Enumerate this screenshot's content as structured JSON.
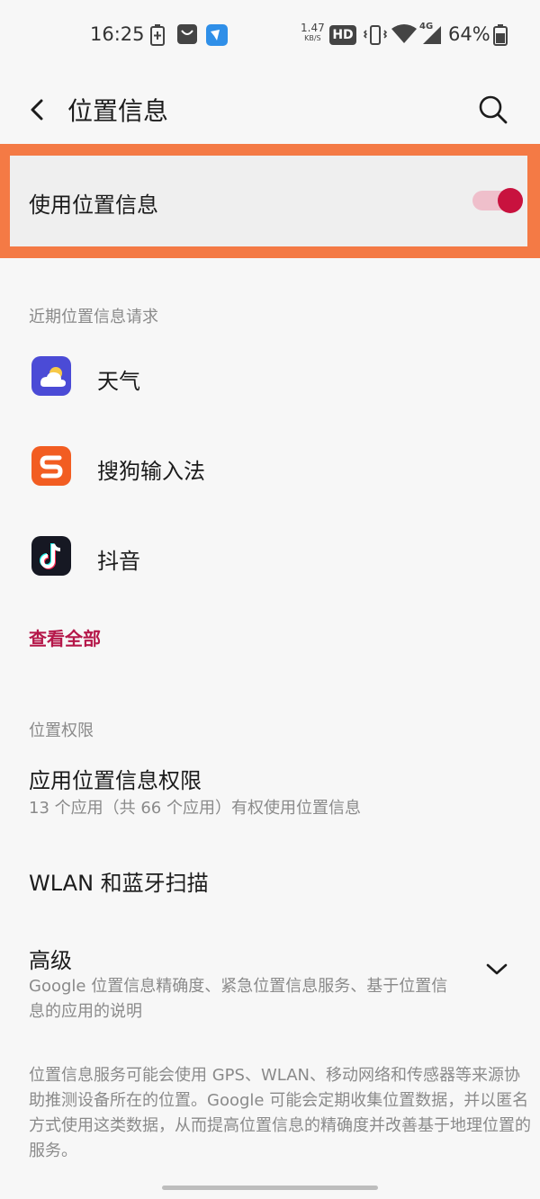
{
  "status_bar": {
    "time": "16:25",
    "net_speed": "1.47",
    "net_speed_unit": "KB/S",
    "hd_badge": "HD",
    "network_type": "4G",
    "battery": "64%"
  },
  "header": {
    "title": "位置信息",
    "back_icon": "back-arrow-icon",
    "search_icon": "search-icon"
  },
  "master_switch": {
    "label": "使用位置信息",
    "enabled": true,
    "accent": "#c8123e",
    "highlight_color": "#f47a45"
  },
  "recent_requests": {
    "header": "近期位置信息请求",
    "apps": [
      {
        "name": "天气",
        "icon": "weather-app-icon"
      },
      {
        "name": "搜狗输入法",
        "icon": "sogou-input-app-icon"
      },
      {
        "name": "抖音",
        "icon": "douyin-app-icon"
      }
    ],
    "see_all": "查看全部"
  },
  "permissions": {
    "header": "位置权限",
    "app_permission_title": "应用位置信息权限",
    "app_permission_summary": "13 个应用（共 66 个应用）有权使用位置信息",
    "wlan_bt_scan": "WLAN 和蓝牙扫描",
    "advanced_title": "高级",
    "advanced_summary": "Google 位置信息精确度、紧急位置信息服务、基于位置信息的应用的说明"
  },
  "footer": {
    "note": "位置信息服务可能会使用 GPS、WLAN、移动网络和传感器等来源协助推测设备所在的位置。Google 可能会定期收集位置数据，并以匿名方式使用这类数据，从而提高位置信息的精确度并改善基于地理位置的服务。"
  }
}
